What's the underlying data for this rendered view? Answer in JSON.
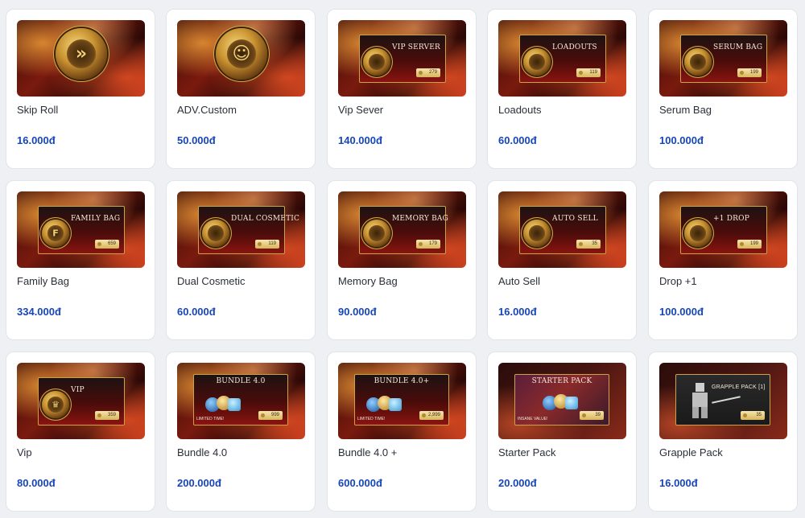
{
  "currency_colors": {
    "price_text": "#1646b8",
    "name_text": "#2a2f38"
  },
  "products": [
    {
      "name": "Skip Roll",
      "price": "16.000đ",
      "emblem_icon": "skip-roll-emblem-icon",
      "banner_title": "",
      "banner_price": ""
    },
    {
      "name": "ADV.Custom",
      "price": "50.000đ",
      "emblem_icon": "adv-custom-emblem-icon",
      "banner_title": "",
      "banner_price": ""
    },
    {
      "name": "Vip Sever",
      "price": "140.000đ",
      "emblem_icon": "vip-server-emblem-icon",
      "banner_title": "VIP SERVER",
      "banner_price": "279"
    },
    {
      "name": "Loadouts",
      "price": "60.000đ",
      "emblem_icon": "loadouts-emblem-icon",
      "banner_title": "LOADOUTS",
      "banner_price": "119"
    },
    {
      "name": "Serum Bag",
      "price": "100.000đ",
      "emblem_icon": "serum-bag-emblem-icon",
      "banner_title": "SERUM BAG",
      "banner_price": "199"
    },
    {
      "name": "Family Bag",
      "price": "334.000đ",
      "emblem_icon": "family-bag-emblem-icon",
      "banner_title": "FAMILY BAG",
      "banner_price": "659"
    },
    {
      "name": "Dual Cosmetic",
      "price": "60.000đ",
      "emblem_icon": "dual-cosmetic-emblem-icon",
      "banner_title": "DUAL COSMETIC",
      "banner_price": "119"
    },
    {
      "name": "Memory Bag",
      "price": "90.000đ",
      "emblem_icon": "memory-bag-emblem-icon",
      "banner_title": "MEMORY BAG",
      "banner_price": "179"
    },
    {
      "name": "Auto Sell",
      "price": "16.000đ",
      "emblem_icon": "auto-sell-emblem-icon",
      "banner_title": "AUTO SELL",
      "banner_price": "35"
    },
    {
      "name": "Drop +1",
      "price": "100.000đ",
      "emblem_icon": "drop-emblem-icon",
      "banner_title": "+1 DROP",
      "banner_price": "199"
    },
    {
      "name": "Vip",
      "price": "80.000đ",
      "emblem_icon": "vip-emblem-icon",
      "banner_title": "VIP",
      "banner_price": "359"
    },
    {
      "name": "Bundle 4.0",
      "price": "200.000đ",
      "emblem_icon": "bundle-orbs-icon",
      "banner_title": "BUNDLE 4.0",
      "banner_price": "999",
      "banner_tag": "LIMITED TIME!"
    },
    {
      "name": "Bundle 4.0 +",
      "price": "600.000đ",
      "emblem_icon": "bundle-orbs-icon",
      "banner_title": "BUNDLE 4.0+",
      "banner_price": "2,999",
      "banner_tag": "LIMITED TIME!"
    },
    {
      "name": "Starter Pack",
      "price": "20.000đ",
      "emblem_icon": "starter-pack-orbs-icon",
      "banner_title": "STARTER PACK",
      "banner_price": "39",
      "banner_tag": "INSANE VALUE!"
    },
    {
      "name": "Grapple Pack",
      "price": "16.000đ",
      "emblem_icon": "grapple-figure-icon",
      "banner_title": "GRAPPLE PACK [1]",
      "banner_price": "35"
    }
  ]
}
